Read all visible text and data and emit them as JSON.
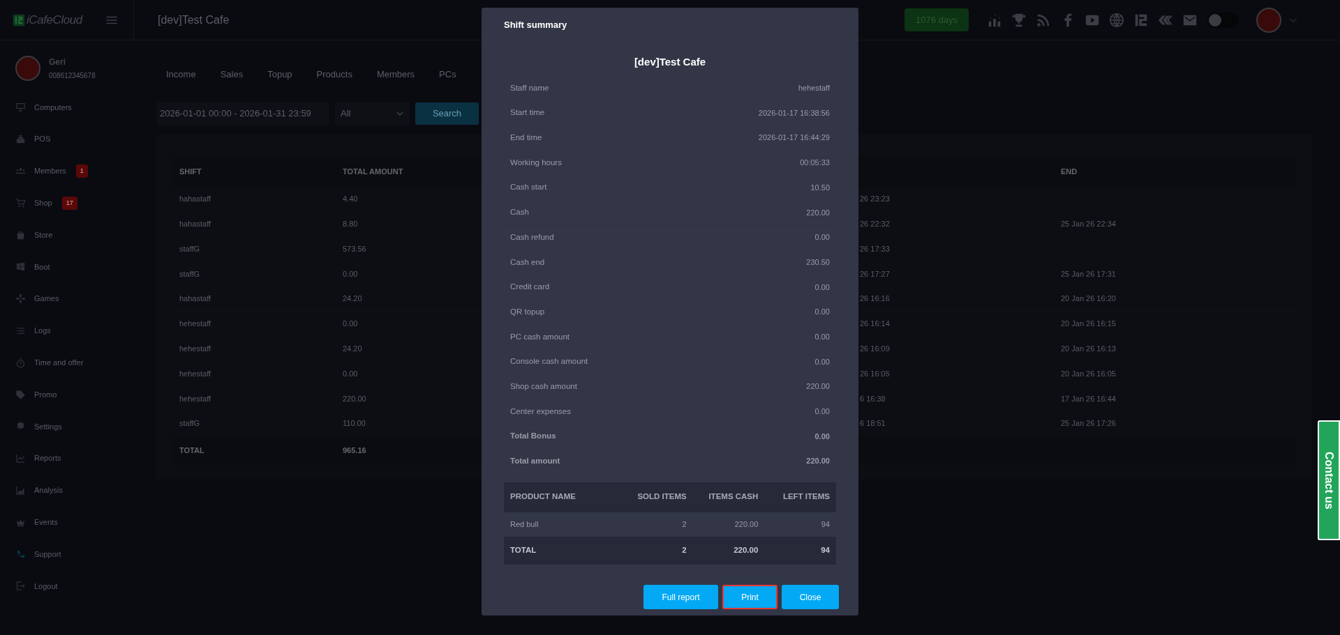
{
  "top_bar": {
    "logo": "iCafeCloud",
    "cafe_name": "[dev]Test Cafe",
    "license_badge": "1076 days",
    "theme_toggle": {
      "on": false
    }
  },
  "profile": {
    "name": "Geri",
    "phone": "008612345678"
  },
  "sidebar": {
    "items": [
      {
        "label": "Computers",
        "kind": "monitor"
      },
      {
        "label": "POS",
        "kind": "register"
      },
      {
        "label": "Members",
        "kind": "people",
        "badge": "1"
      },
      {
        "label": "Shop",
        "kind": "cart",
        "badge": "17"
      },
      {
        "label": "Store",
        "kind": "bag"
      },
      {
        "label": "Boot",
        "kind": "windows"
      },
      {
        "label": "Games",
        "kind": "gamepad"
      },
      {
        "label": "Logs",
        "kind": "list"
      },
      {
        "label": "Time and offer",
        "kind": "timer"
      },
      {
        "label": "Promo",
        "kind": "tag"
      },
      {
        "label": "Settings",
        "kind": "gear"
      },
      {
        "label": "Reports",
        "kind": "chart"
      },
      {
        "label": "Analysis",
        "kind": "area"
      },
      {
        "label": "Events",
        "kind": "crown"
      },
      {
        "label": "Support",
        "kind": "phone"
      },
      {
        "label": "Logout",
        "kind": "logout"
      }
    ]
  },
  "report_tabs": [
    "Income",
    "Sales",
    "Topup",
    "Products",
    "Members",
    "PCs"
  ],
  "filters": {
    "date_range": "2026-01-01 00:00 - 2026-01-31 23:59",
    "type_select": "All",
    "search_button": "Search"
  },
  "shift_table": {
    "columns": {
      "shift": "SHIFT",
      "total_amount": "TOTAL AMOUNT",
      "end": "END"
    },
    "rows": [
      {
        "shift": "hahastaff",
        "total_amount": "4.40",
        "column_3": "26 23:23"
      },
      {
        "shift": "hahastaff",
        "total_amount": "8.80",
        "column_3": "26 22:32",
        "end": "25 Jan 26 22:34"
      },
      {
        "shift": "staffG",
        "total_amount": "573.56",
        "column_3": "26 17:33"
      },
      {
        "shift": "staffG",
        "total_amount": "0.00",
        "column_3": "26 17:27",
        "end": "25 Jan 26 17:31"
      },
      {
        "shift": "hahastaff",
        "total_amount": "24.20",
        "column_3": "26 16:16",
        "end": "20 Jan 26 16:20"
      },
      {
        "shift": "hehestaff",
        "total_amount": "0.00",
        "column_3": "26 16:14",
        "end": "20 Jan 26 16:15"
      },
      {
        "shift": "hehestaff",
        "total_amount": "24.20",
        "column_3": "26 16:09",
        "end": "20 Jan 26 16:13"
      },
      {
        "shift": "hehestaff",
        "total_amount": "0.00",
        "column_3": "26 16:05",
        "end": "20 Jan 26 16:05"
      },
      {
        "shift": "hehestaff",
        "total_amount": "220.00",
        "column_3": "6 16:38",
        "end": "17 Jan 26 16:44"
      },
      {
        "shift": "staffG",
        "total_amount": "110.00",
        "column_3": "6 18:51",
        "end": "25 Jan 26 17:26"
      }
    ],
    "total": {
      "shift": "TOTAL",
      "total_amount": "965.16"
    }
  },
  "modal": {
    "title": "Shift summary",
    "cafe_name": "[dev]Test Cafe",
    "rows": [
      {
        "label": "Staff name",
        "value": "hehestaff",
        "bold": false
      },
      {
        "label": "Start time",
        "value": "2026-01-17 16:38:56",
        "bold": false
      },
      {
        "label": "End time",
        "value": "2026-01-17 16:44:29",
        "bold": false
      },
      {
        "label": "Working hours",
        "value": "00:05:33",
        "bold": false
      },
      {
        "label": "Cash start",
        "value": "10.50",
        "bold": false
      },
      {
        "label": "Cash",
        "value": "220.00",
        "bold": false
      },
      {
        "label": "Cash refund",
        "value": "0.00",
        "bold": false
      },
      {
        "label": "Cash end",
        "value": "230.50",
        "bold": false
      },
      {
        "label": "Credit card",
        "value": "0.00",
        "bold": false
      },
      {
        "label": "QR topup",
        "value": "0.00",
        "bold": false
      },
      {
        "label": "PC cash amount",
        "value": "0.00",
        "bold": false
      },
      {
        "label": "Console cash amount",
        "value": "0.00",
        "bold": false
      },
      {
        "label": "Shop cash amount",
        "value": "220.00",
        "bold": false
      },
      {
        "label": "Center expenses",
        "value": "0.00",
        "bold": false
      },
      {
        "label": "Total Bonus",
        "value": "0.00",
        "bold": true
      },
      {
        "label": "Total amount",
        "value": "220.00",
        "bold": true
      }
    ],
    "products": {
      "columns": [
        "PRODUCT NAME",
        "SOLD ITEMS",
        "ITEMS CASH",
        "LEFT ITEMS"
      ],
      "rows": [
        [
          "Red bull",
          "2",
          "220.00",
          "94"
        ]
      ],
      "total": [
        "TOTAL",
        "2",
        "220.00",
        "94"
      ]
    },
    "buttons": [
      {
        "label": "Full report",
        "focused": false
      },
      {
        "label": "Print",
        "focused": true
      },
      {
        "label": "Close",
        "focused": false
      }
    ]
  },
  "contact_button": "Contact us"
}
